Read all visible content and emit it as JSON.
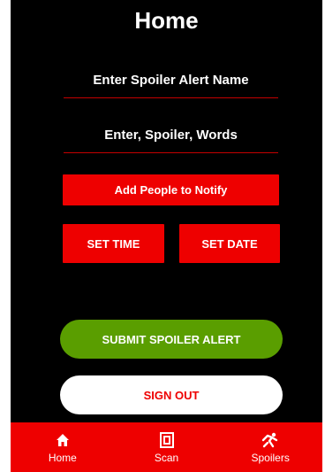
{
  "app": {
    "title": "Home"
  },
  "form": {
    "name_placeholder": "Enter Spoiler Alert Name",
    "words_placeholder": "Enter, Spoiler, Words"
  },
  "buttons": {
    "add_people": "Add People to Notify",
    "set_time": "SET TIME",
    "set_date": "SET DATE",
    "submit": "SUBMIT SPOILER ALERT",
    "sign_out": "SIGN OUT"
  },
  "bottom_nav": {
    "items": [
      {
        "label": "Home",
        "icon": "home-icon"
      },
      {
        "label": "Scan",
        "icon": "scan-icon"
      },
      {
        "label": "Spoilers",
        "icon": "spoilers-icon"
      }
    ]
  },
  "colors": {
    "background": "#000000",
    "accent_red": "#ee0000",
    "underline_red": "#c40000",
    "submit_green": "#5a9e00",
    "sign_out_text": "#ee0000"
  }
}
